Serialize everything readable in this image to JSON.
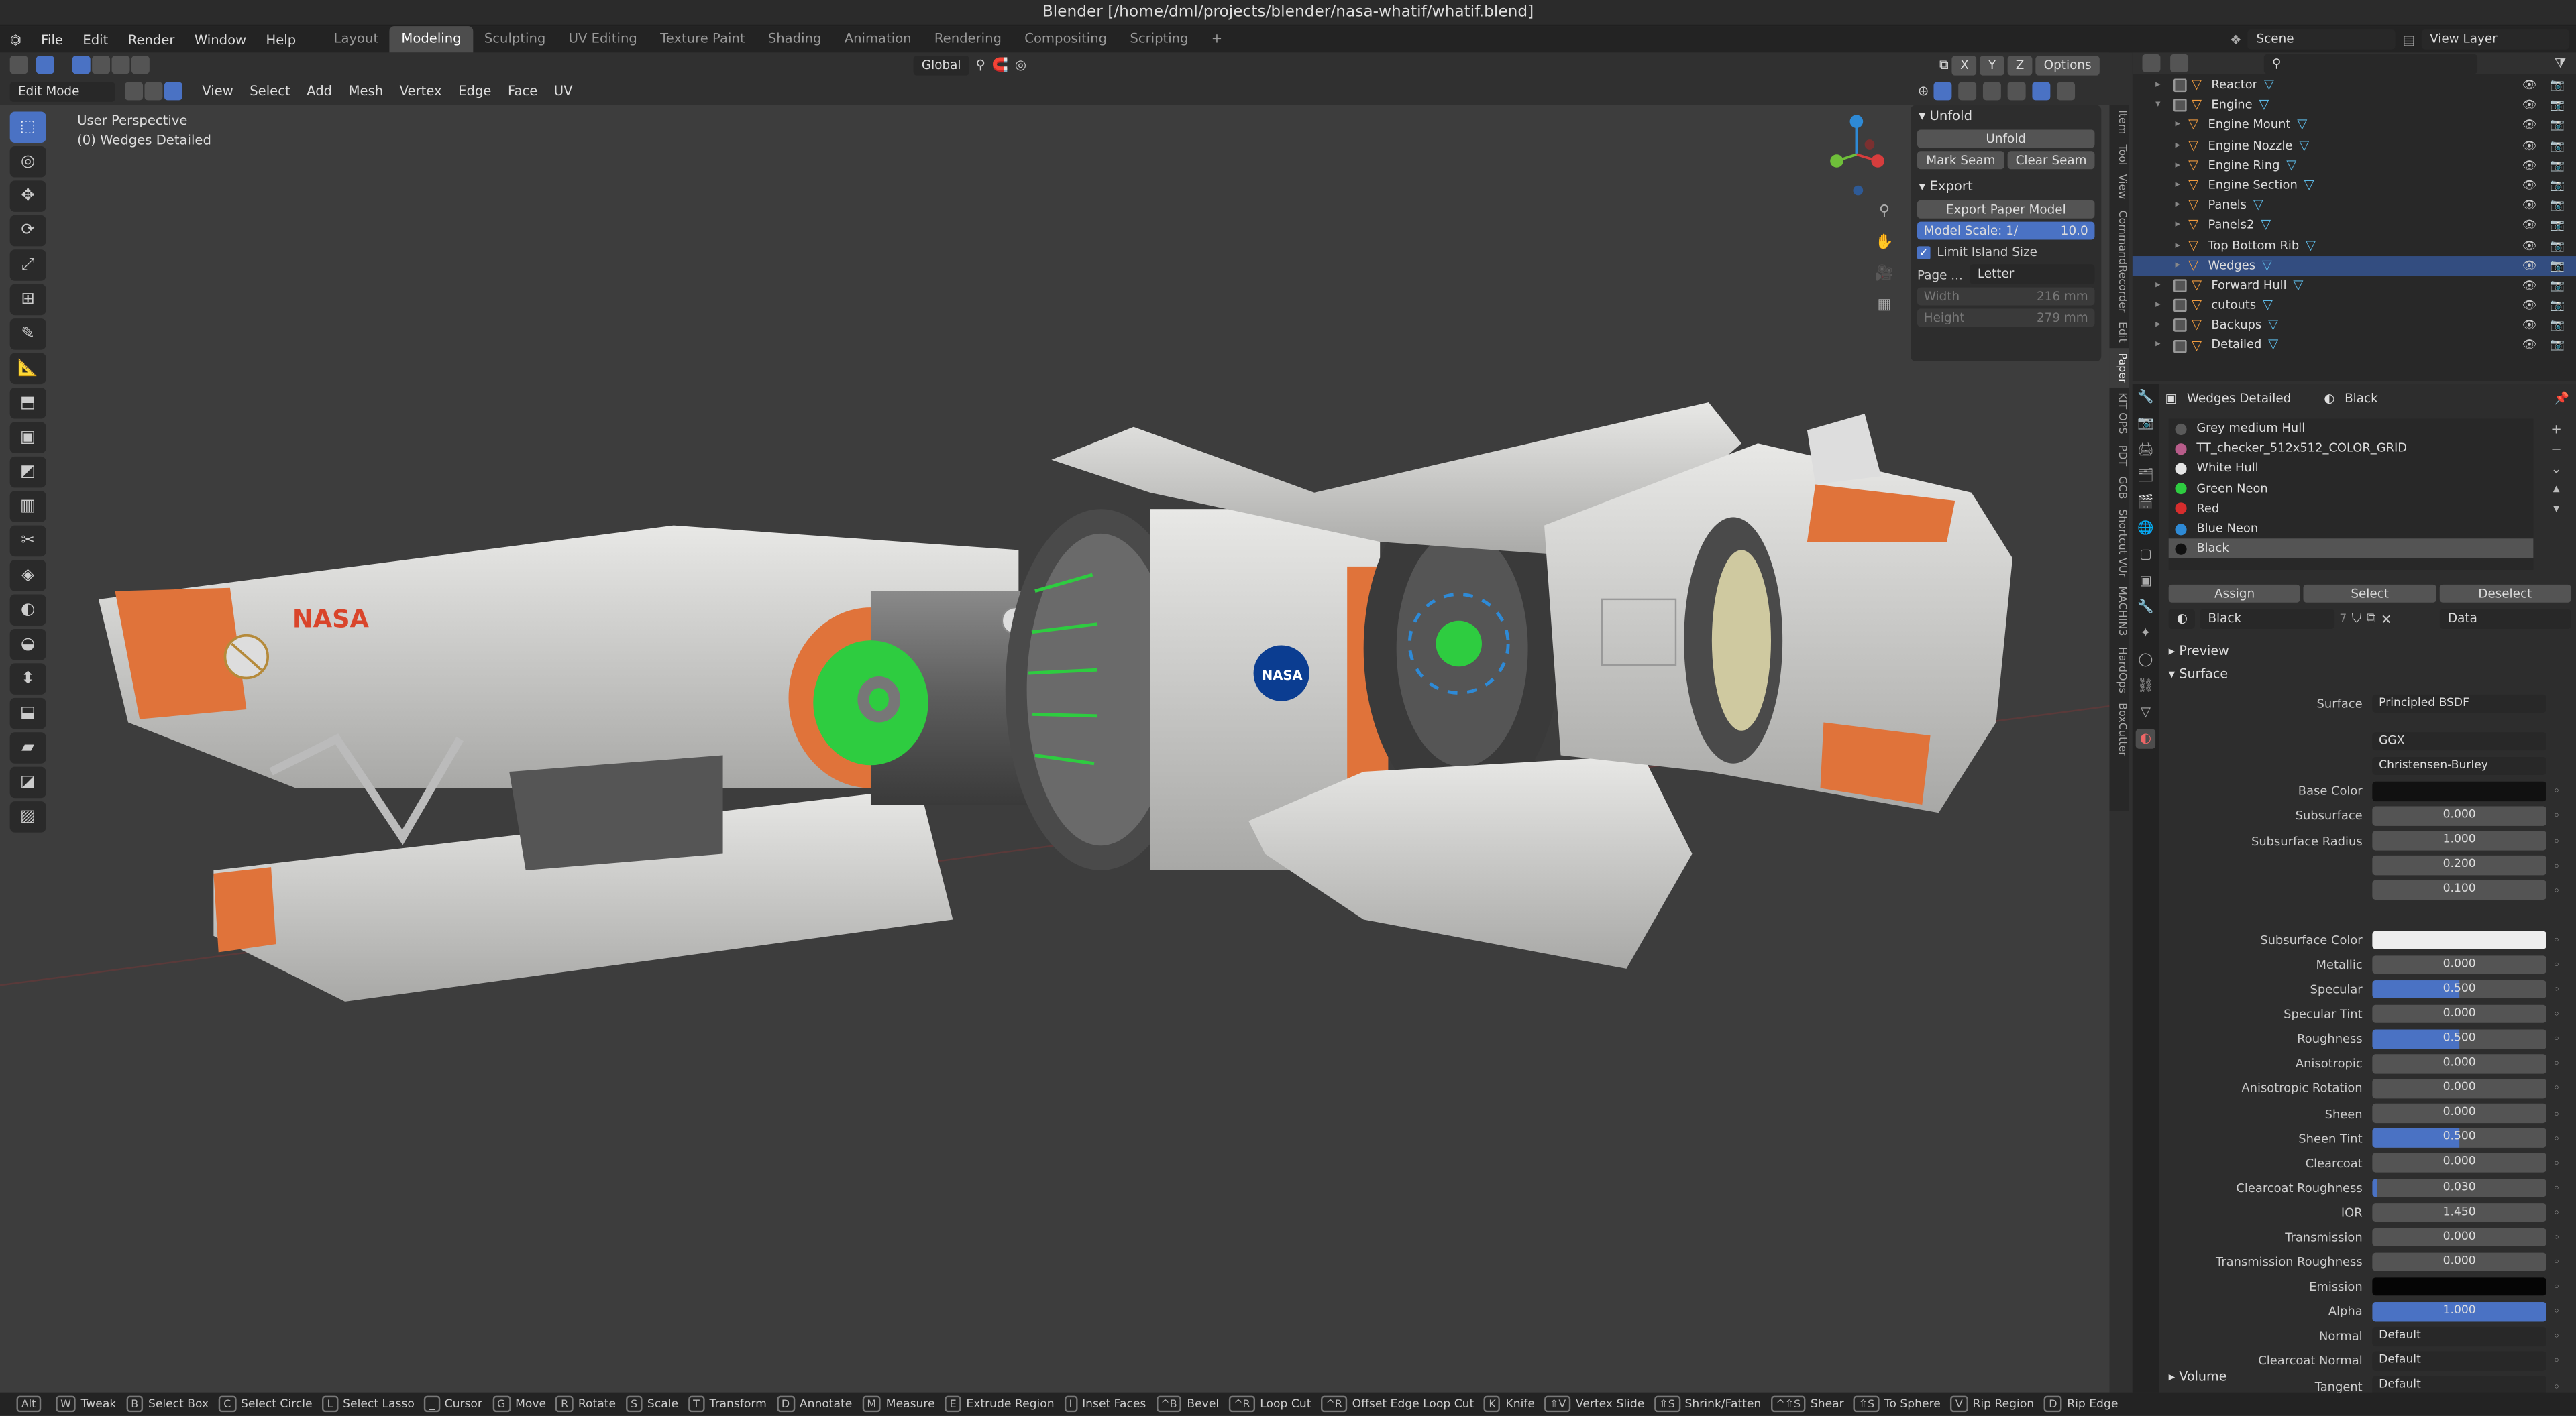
{
  "window": {
    "title": "Blender [/home/dml/projects/blender/nasa-whatif/whatif.blend]"
  },
  "menus": [
    "File",
    "Edit",
    "Render",
    "Window",
    "Help"
  ],
  "workspaces": [
    "Layout",
    "Modeling",
    "Sculpting",
    "UV Editing",
    "Texture Paint",
    "Shading",
    "Animation",
    "Rendering",
    "Compositing",
    "Scripting"
  ],
  "active_workspace": "Modeling",
  "scene": "Scene",
  "view_layer": "View Layer",
  "header": {
    "transform_orientation": "Global",
    "options": "Options",
    "axes": [
      "X",
      "Y",
      "Z"
    ]
  },
  "mode": {
    "label": "Edit Mode",
    "menus": [
      "View",
      "Select",
      "Add",
      "Mesh",
      "Vertex",
      "Edge",
      "Face",
      "UV"
    ]
  },
  "viewport": {
    "perspective": "User Perspective",
    "object": "(0) Wedges Detailed"
  },
  "npanel": {
    "unfold_title": "Unfold",
    "unfold_btn": "Unfold",
    "mark_seam": "Mark Seam",
    "clear_seam": "Clear Seam",
    "export_title": "Export",
    "export_btn": "Export Paper Model",
    "model_scale_label": "Model Scale: 1/",
    "model_scale_value": "10.0",
    "limit_island": "Limit Island Size",
    "page_label": "Page ...",
    "page_value": "Letter",
    "width_label": "Width",
    "width_value": "216 mm",
    "height_label": "Height",
    "height_value": "279 mm"
  },
  "ntabs": [
    "Item",
    "Tool",
    "View",
    "CommandRecorder",
    "Edit",
    "Paper",
    "KIT OPS",
    "PDT",
    "GCB",
    "Shortcut VUr",
    "MACHIN3",
    "HardOps",
    "BoxCutter"
  ],
  "outliner": [
    {
      "name": "Reactor",
      "indent": 1,
      "exp": "▸",
      "sel": false
    },
    {
      "name": "Engine",
      "indent": 1,
      "exp": "▾",
      "sel": false
    },
    {
      "name": "Engine Mount",
      "indent": 2,
      "exp": "▸",
      "sel": false
    },
    {
      "name": "Engine Nozzle",
      "indent": 2,
      "exp": "▸",
      "sel": false
    },
    {
      "name": "Engine Ring",
      "indent": 2,
      "exp": "▸",
      "sel": false
    },
    {
      "name": "Engine Section",
      "indent": 2,
      "exp": "▸",
      "sel": false
    },
    {
      "name": "Panels",
      "indent": 2,
      "exp": "▸",
      "sel": false
    },
    {
      "name": "Panels2",
      "indent": 2,
      "exp": "▸",
      "sel": false
    },
    {
      "name": "Top Bottom Rib",
      "indent": 2,
      "exp": "▸",
      "sel": false
    },
    {
      "name": "Wedges",
      "indent": 2,
      "exp": "▸",
      "sel": true
    },
    {
      "name": "Forward Hull",
      "indent": 1,
      "exp": "▸",
      "sel": false
    },
    {
      "name": "cutouts",
      "indent": 1,
      "exp": "▸",
      "sel": false
    },
    {
      "name": "Backups",
      "indent": 1,
      "exp": "▸",
      "sel": false
    },
    {
      "name": "Detailed",
      "indent": 1,
      "exp": "▸",
      "sel": false
    }
  ],
  "properties": {
    "object": "Wedges Detailed",
    "material": "Black",
    "materials": [
      {
        "name": "Grey medium Hull",
        "color": "#5a5a5a"
      },
      {
        "name": "TT_checker_512x512_COLOR_GRID",
        "color": "#b85c8a"
      },
      {
        "name": "White Hull",
        "color": "#e6e6e6"
      },
      {
        "name": "Green Neon",
        "color": "#2ecc40"
      },
      {
        "name": "Red",
        "color": "#d62d2d"
      },
      {
        "name": "Blue Neon",
        "color": "#2e8ad6"
      },
      {
        "name": "Black",
        "color": "#111111"
      }
    ],
    "assign": "Assign",
    "select": "Select",
    "deselect": "Deselect",
    "mat_name": "Black",
    "mat_users": "7",
    "data": "Data",
    "preview": "Preview",
    "surface_panel": "Surface",
    "volume": "Volume",
    "surface": "Principled BSDF",
    "distribution": "GGX",
    "subsurface_method": "Christensen-Burley",
    "rows": [
      {
        "label": "Base Color",
        "value": "",
        "color": "#111111"
      },
      {
        "label": "Subsurface",
        "value": "0.000"
      },
      {
        "label": "Subsurface Radius",
        "value": "1.000"
      },
      {
        "label": "",
        "value": "0.200"
      },
      {
        "label": "",
        "value": "0.100"
      },
      {
        "label": "",
        "value": ""
      },
      {
        "label": "Subsurface Color",
        "value": "",
        "color": "#eeeeee"
      },
      {
        "label": "Metallic",
        "value": "0.000"
      },
      {
        "label": "Specular",
        "value": "0.500",
        "fill": 0.5
      },
      {
        "label": "Specular Tint",
        "value": "0.000"
      },
      {
        "label": "Roughness",
        "value": "0.500",
        "fill": 0.5
      },
      {
        "label": "Anisotropic",
        "value": "0.000"
      },
      {
        "label": "Anisotropic Rotation",
        "value": "0.000"
      },
      {
        "label": "Sheen",
        "value": "0.000"
      },
      {
        "label": "Sheen Tint",
        "value": "0.500",
        "fill": 0.5
      },
      {
        "label": "Clearcoat",
        "value": "0.000"
      },
      {
        "label": "Clearcoat Roughness",
        "value": "0.030",
        "fill": 0.03
      },
      {
        "label": "IOR",
        "value": "1.450"
      },
      {
        "label": "Transmission",
        "value": "0.000"
      },
      {
        "label": "Transmission Roughness",
        "value": "0.000"
      },
      {
        "label": "Emission",
        "value": "",
        "color": "#050505"
      },
      {
        "label": "Alpha",
        "value": "1.000",
        "fill": 1.0
      },
      {
        "label": "Normal",
        "value": "Default",
        "text": true
      },
      {
        "label": "Clearcoat Normal",
        "value": "Default",
        "text": true
      },
      {
        "label": "Tangent",
        "value": "Default",
        "text": true
      }
    ]
  },
  "statusbar": [
    {
      "key": "Alt",
      "label": ""
    },
    {
      "key": "W",
      "label": "Tweak"
    },
    {
      "key": "B",
      "label": "Select Box"
    },
    {
      "key": "C",
      "label": "Select Circle"
    },
    {
      "key": "L",
      "label": "Select Lasso"
    },
    {
      "key": "_",
      "label": "Cursor"
    },
    {
      "key": "G",
      "label": "Move"
    },
    {
      "key": "R",
      "label": "Rotate"
    },
    {
      "key": "S",
      "label": "Scale"
    },
    {
      "key": "T",
      "label": "Transform"
    },
    {
      "key": "D",
      "label": "Annotate"
    },
    {
      "key": "M",
      "label": "Measure"
    },
    {
      "key": "E",
      "label": "Extrude Region"
    },
    {
      "key": "I",
      "label": "Inset Faces"
    },
    {
      "key": "^B",
      "label": "Bevel"
    },
    {
      "key": "^R",
      "label": "Loop Cut"
    },
    {
      "key": "^R",
      "label": "Offset Edge Loop Cut"
    },
    {
      "key": "K",
      "label": "Knife"
    },
    {
      "key": "⇧V",
      "label": "Vertex Slide"
    },
    {
      "key": "⇧S",
      "label": "Shrink/Fatten"
    },
    {
      "key": "^⇧S",
      "label": "Shear"
    },
    {
      "key": "⇧S",
      "label": "To Sphere"
    },
    {
      "key": "V",
      "label": "Rip Region"
    },
    {
      "key": "D",
      "label": "Rip Edge"
    }
  ]
}
